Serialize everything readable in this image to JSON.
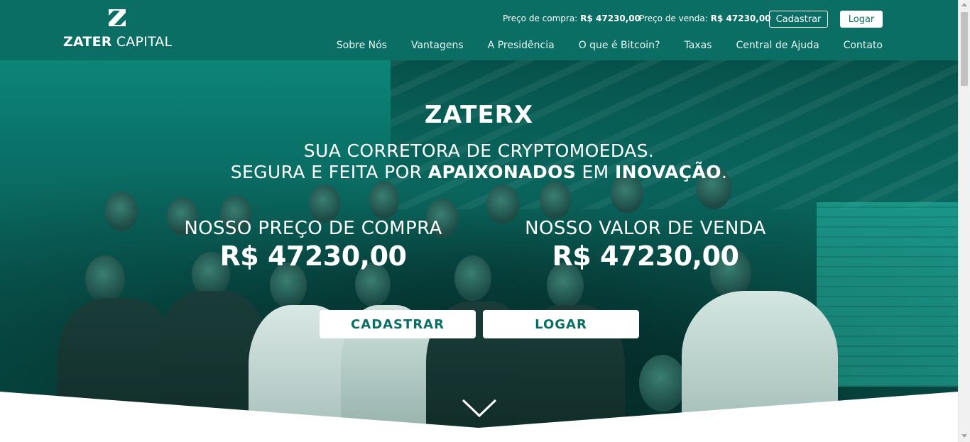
{
  "brand": {
    "name_bold": "ZATER",
    "name_light": "CAPITAL",
    "logo_icon": "z-logo-icon"
  },
  "ticker": {
    "buy_label": "Preço de compra:",
    "buy_value": "R$ 47230,00",
    "sell_label": "Preço de venda:",
    "sell_value": "R$ 47230,00"
  },
  "top_buttons": {
    "cadastrar": "Cadastrar",
    "logar": "Logar"
  },
  "nav": {
    "items": [
      "Sobre Nós",
      "Vantagens",
      "A Presidência",
      "O que é Bitcoin?",
      "Taxas",
      "Central de Ajuda",
      "Contato"
    ]
  },
  "hero": {
    "title": "ZATERX",
    "subtitle_line1": "SUA CORRETORA DE CRYPTOMOEDAS.",
    "subtitle_line2_a": "SEGURA E FEITA POR ",
    "subtitle_line2_b": "APAIXONADOS",
    "subtitle_line2_c": " EM ",
    "subtitle_line2_d": "INOVAÇÃO",
    "subtitle_line2_e": ".",
    "buy_label": "NOSSO PREÇO DE COMPRA",
    "buy_value": "R$ 47230,00",
    "sell_label": "NOSSO VALOR DE VENDA",
    "sell_value": "R$ 47230,00",
    "cta_cadastrar": "CADASTRAR",
    "cta_logar": "LOGAR",
    "scroll_icon": "chevron-down-icon"
  },
  "colors": {
    "brand_teal": "#0b6e64",
    "white": "#ffffff"
  }
}
